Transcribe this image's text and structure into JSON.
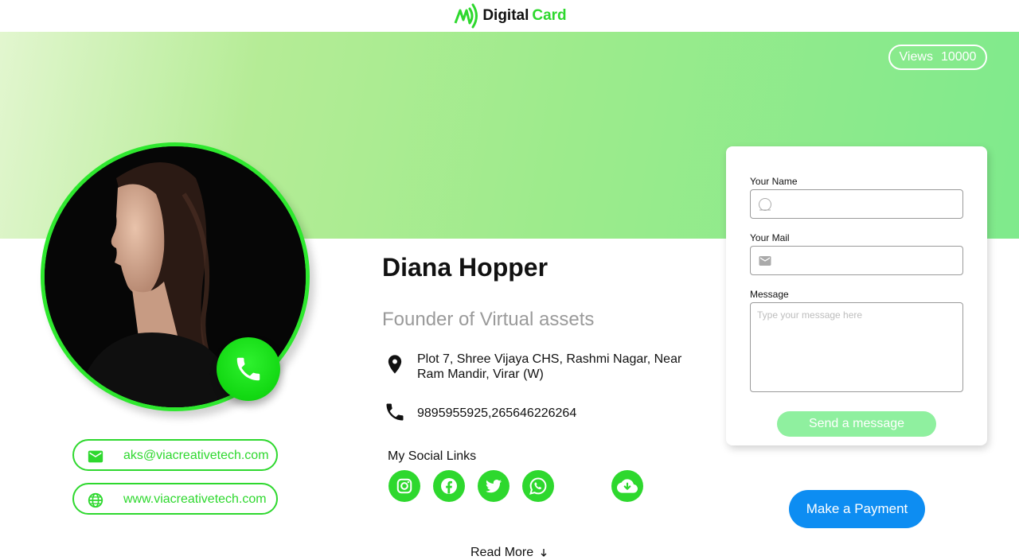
{
  "header": {
    "logo_word1": "Digital",
    "logo_word2": "Card"
  },
  "views": {
    "label": "Views",
    "count": "10000"
  },
  "profile": {
    "name": "Diana Hopper",
    "role": "Founder of Virtual assets",
    "address": "Plot 7, Shree Vijaya CHS, Rashmi Nagar, Near Ram Mandir, Virar (W)",
    "phone": "9895955925,265646226264",
    "email": "aks@viacreativetech.com",
    "website": "www.viacreativetech.com"
  },
  "social": {
    "title": "My Social Links",
    "icons": [
      "instagram-icon",
      "facebook-icon",
      "twitter-icon",
      "whatsapp-icon",
      "cloud-download-icon"
    ]
  },
  "read_more": "Read More",
  "contact_form": {
    "name_label": "Your Name",
    "mail_label": "Your Mail",
    "message_label": "Message",
    "message_placeholder": "Type your message here",
    "send_label": "Send a message"
  },
  "payment": {
    "label": "Make a Payment"
  },
  "colors": {
    "accent": "#2ed82e",
    "payment": "#0d8df2",
    "muted": "#9a9a9a"
  }
}
